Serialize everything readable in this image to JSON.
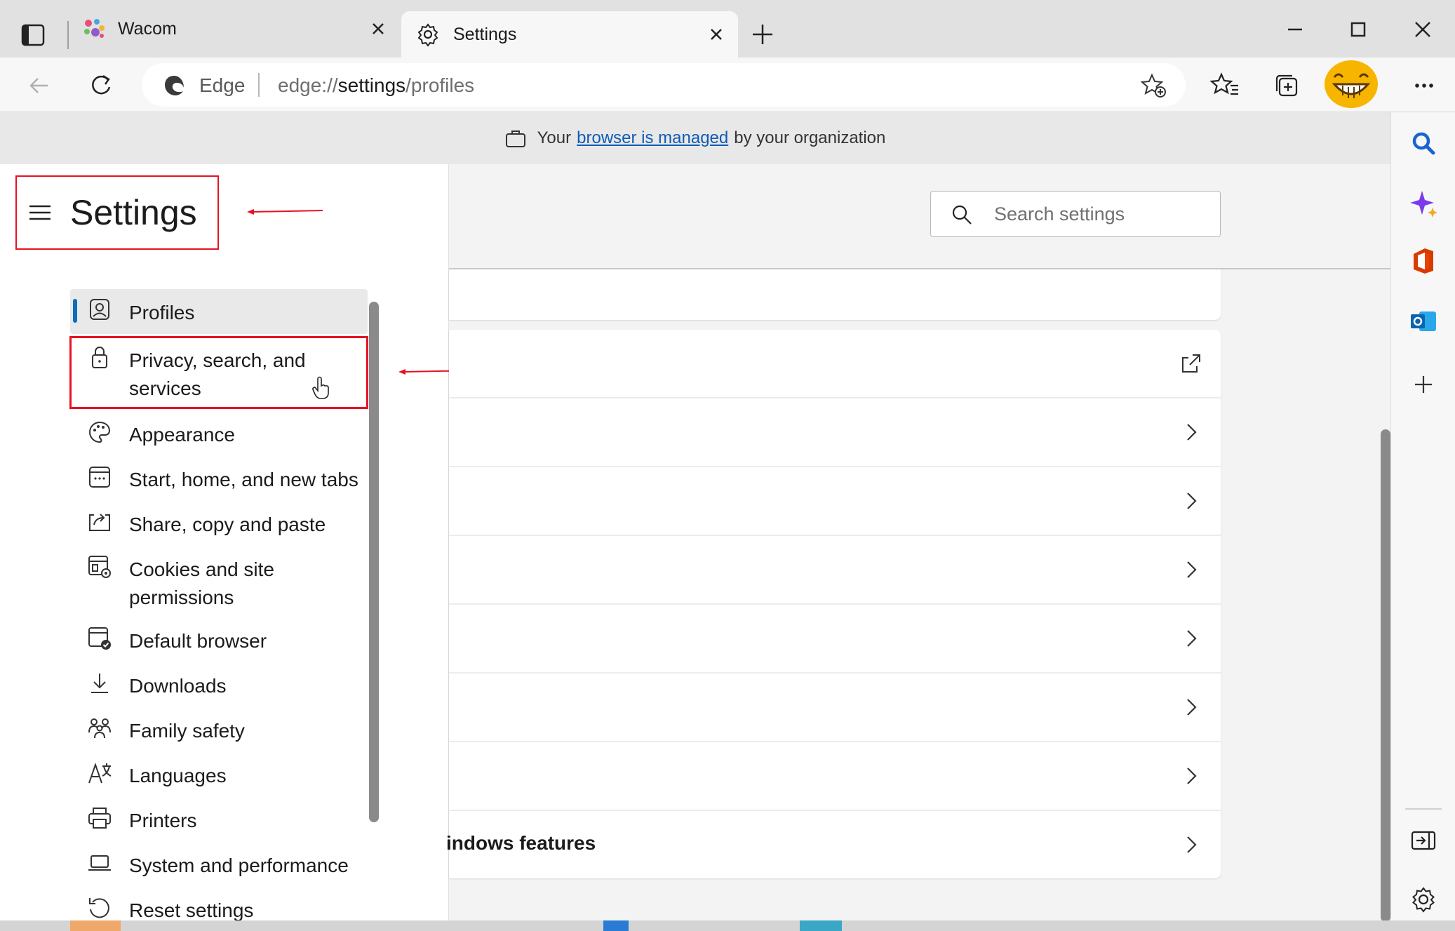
{
  "tabs": [
    {
      "label": "Wacom",
      "active": false
    },
    {
      "label": "Settings",
      "active": true
    }
  ],
  "address": {
    "site_label": "Edge",
    "url_prefix": "edge://",
    "url_host": "settings",
    "url_path": "/profiles"
  },
  "banner": {
    "prefix": "Your",
    "link": "browser is managed",
    "suffix": "by your organization"
  },
  "settings": {
    "title": "Settings",
    "search_placeholder": "Search settings"
  },
  "nav": {
    "items": [
      {
        "label": "Profiles",
        "icon": "profiles-icon",
        "selected": true
      },
      {
        "label": "Privacy, search, and services",
        "icon": "lock-icon",
        "selected": false
      },
      {
        "label": "Appearance",
        "icon": "palette-icon",
        "selected": false
      },
      {
        "label": "Start, home, and new tabs",
        "icon": "start-page-icon",
        "selected": false
      },
      {
        "label": "Share, copy and paste",
        "icon": "share-icon",
        "selected": false
      },
      {
        "label": "Cookies and site permissions",
        "icon": "cookies-icon",
        "selected": false
      },
      {
        "label": "Default browser",
        "icon": "default-browser-icon",
        "selected": false
      },
      {
        "label": "Downloads",
        "icon": "download-icon",
        "selected": false
      },
      {
        "label": "Family safety",
        "icon": "family-icon",
        "selected": false
      },
      {
        "label": "Languages",
        "icon": "languages-icon",
        "selected": false
      },
      {
        "label": "Printers",
        "icon": "printer-icon",
        "selected": false
      },
      {
        "label": "System and performance",
        "icon": "laptop-icon",
        "selected": false
      },
      {
        "label": "Reset settings",
        "icon": "reset-icon",
        "selected": false
      }
    ]
  },
  "main": {
    "rows": [
      {
        "label": "",
        "action": "external-link-icon"
      },
      {
        "label": "",
        "action": "chevron-right-icon"
      },
      {
        "label": "",
        "action": "chevron-right-icon"
      },
      {
        "label": "",
        "action": "chevron-right-icon"
      },
      {
        "label": "",
        "action": "chevron-right-icon"
      },
      {
        "label": "",
        "action": "chevron-right-icon"
      },
      {
        "label": "",
        "action": "chevron-right-icon"
      },
      {
        "label": "indows features",
        "action": "chevron-right-icon"
      }
    ]
  },
  "colors": {
    "accent": "#0f6cbd",
    "annotation": "#e81123",
    "link": "#0f5cb5"
  }
}
